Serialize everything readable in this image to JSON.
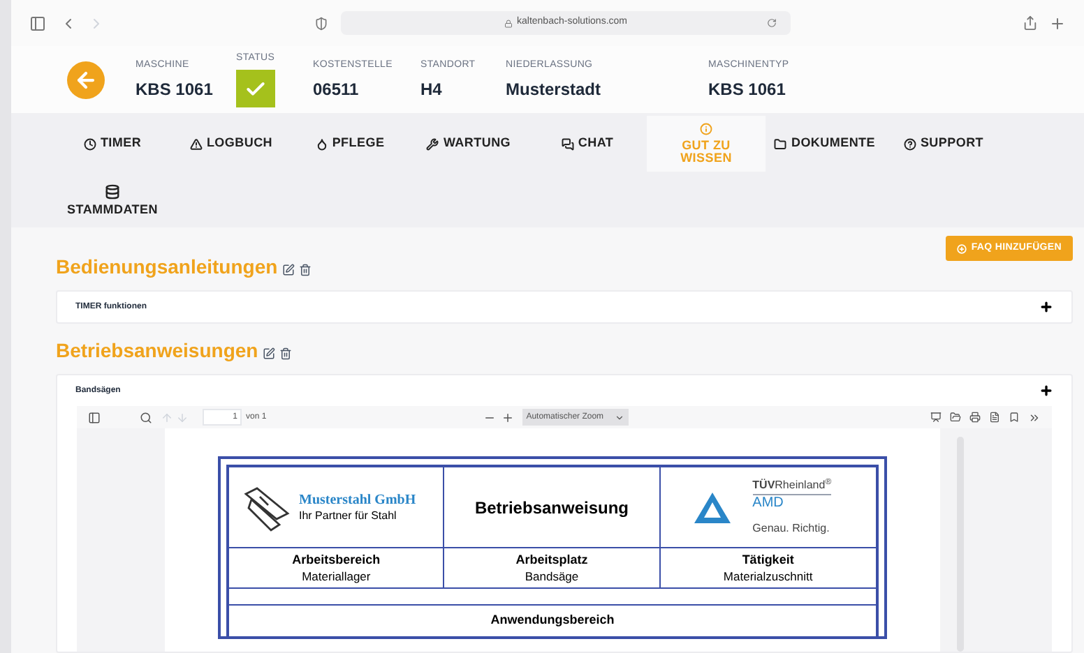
{
  "browser": {
    "url": "kaltenbach-solutions.com"
  },
  "header": {
    "fields": [
      {
        "kind": "text",
        "label": "MASCHINE",
        "value": "KBS 1061"
      },
      {
        "kind": "status",
        "label": "STATUS",
        "checked": true
      },
      {
        "kind": "text",
        "label": "KOSTENSTELLE",
        "value": "06511"
      },
      {
        "kind": "text",
        "label": "STANDORT",
        "value": "H4"
      },
      {
        "kind": "text",
        "label": "NIEDERLASSUNG",
        "value": "Musterstadt"
      },
      {
        "kind": "text",
        "label": "MASCHINENTYP",
        "value": "KBS 1061"
      }
    ]
  },
  "tabs": [
    {
      "label": "TIMER",
      "selected": false
    },
    {
      "label": "LOGBUCH",
      "selected": false
    },
    {
      "label": "PFLEGE",
      "selected": false
    },
    {
      "label": "WARTUNG",
      "selected": false
    },
    {
      "label": "CHAT",
      "selected": false
    },
    {
      "label": "GUT ZU WISSEN",
      "selected": true
    },
    {
      "label": "DOKUMENTE",
      "selected": false
    },
    {
      "label": "SUPPORT",
      "selected": false
    },
    {
      "label": "STAMMDATEN",
      "selected": false
    }
  ],
  "faq_button": {
    "label": "FAQ HINZUFÜGEN"
  },
  "sections": [
    {
      "title": "Bedienungsanleitungen",
      "items": [
        {
          "title": "TIMER funktionen",
          "expanded": false
        }
      ]
    },
    {
      "title": "Betriebsanweisungen",
      "items": [
        {
          "title": "Bandsägen",
          "expanded": true
        }
      ]
    }
  ],
  "pdf_viewer": {
    "page": "1",
    "page_count": "von 1",
    "zoom": "Automatischer Zoom"
  },
  "document": {
    "company": "Musterstahl GmbH",
    "tagline": "Ihr Partner für Stahl",
    "title": "Betriebsanweisung",
    "cert_brand": "**TÜV**Rheinland$^{®}$",
    "cert_unit": "AMD",
    "cert_slogan": "Genau. Richtig.",
    "columns": [
      {
        "heading": "Arbeitsbereich",
        "value": "Materiallager"
      },
      {
        "heading": "Arbeitsplatz",
        "value": "Bandsäge"
      },
      {
        "heading": "Tätigkeit",
        "value": "Materialzuschnitt"
      }
    ],
    "section_heading": "Anwendungsbereich"
  }
}
